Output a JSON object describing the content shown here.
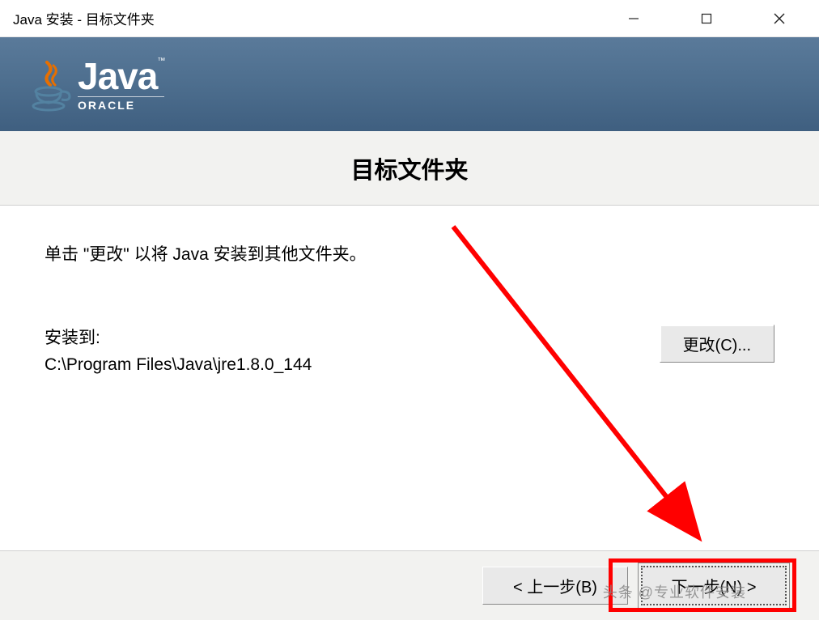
{
  "titlebar": {
    "title": "Java 安装 - 目标文件夹"
  },
  "banner": {
    "logo_main": "Java",
    "logo_tm": "™",
    "logo_sub": "ORACLE"
  },
  "heading": "目标文件夹",
  "content": {
    "instruction": "单击 \"更改\" 以将 Java 安装到其他文件夹。",
    "install_label": "安装到:",
    "install_path": "C:\\Program Files\\Java\\jre1.8.0_144",
    "change_button": "更改(C)..."
  },
  "footer": {
    "back_button": "< 上一步(B)",
    "next_button": "下一步(N) >"
  },
  "watermark": "头条 @专业软件安装"
}
